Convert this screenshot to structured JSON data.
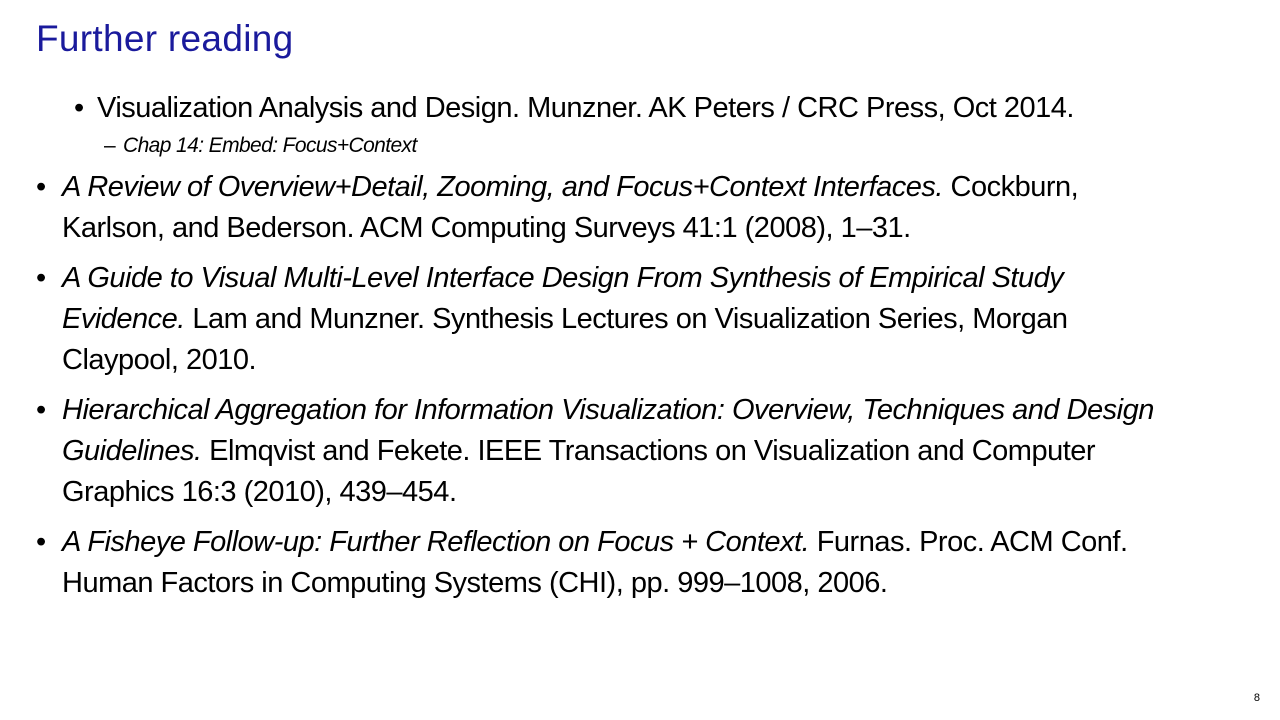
{
  "slide": {
    "title": "Further reading",
    "page_number": "8",
    "bullet_glyph": "•",
    "dash_glyph": "–"
  },
  "references": [
    {
      "italic": "",
      "normal": "Visualization Analysis and Design. Munzner.  AK Peters / CRC Press, Oct 2014.",
      "sub": "Chap 14: Embed: Focus+Context"
    },
    {
      "italic": "A Review of Overview+Detail, Zooming, and Focus+Context Interfaces.",
      "line1_normal": " Cockburn,",
      "line2": "Karlson, and Bederson.  ACM Computing Surveys 41:1 (2008), 1–31."
    },
    {
      "italic_line1": "A Guide to Visual Multi-Level Interface Design From Synthesis of Empirical Study",
      "italic_line2": "Evidence.",
      "normal_line2": " Lam and Munzner. Synthesis Lectures on Visualization Series, Morgan",
      "line3": "Claypool, 2010."
    },
    {
      "italic_line1": "Hierarchical Aggregation for Information Visualization: Overview, Techniques and Design",
      "italic_line2": "Guidelines.",
      "normal_line2": " Elmqvist and Fekete. IEEE Transactions on Visualization and Computer",
      "line3": "Graphics 16:3 (2010), 439–454."
    },
    {
      "italic": "A Fisheye Follow-up: Further Reflection on Focus + Context.",
      "line1_normal": " Furnas. Proc. ACM Conf.",
      "line2": "Human Factors in Computing Systems (CHI), pp. 999–1008, 2006."
    }
  ]
}
